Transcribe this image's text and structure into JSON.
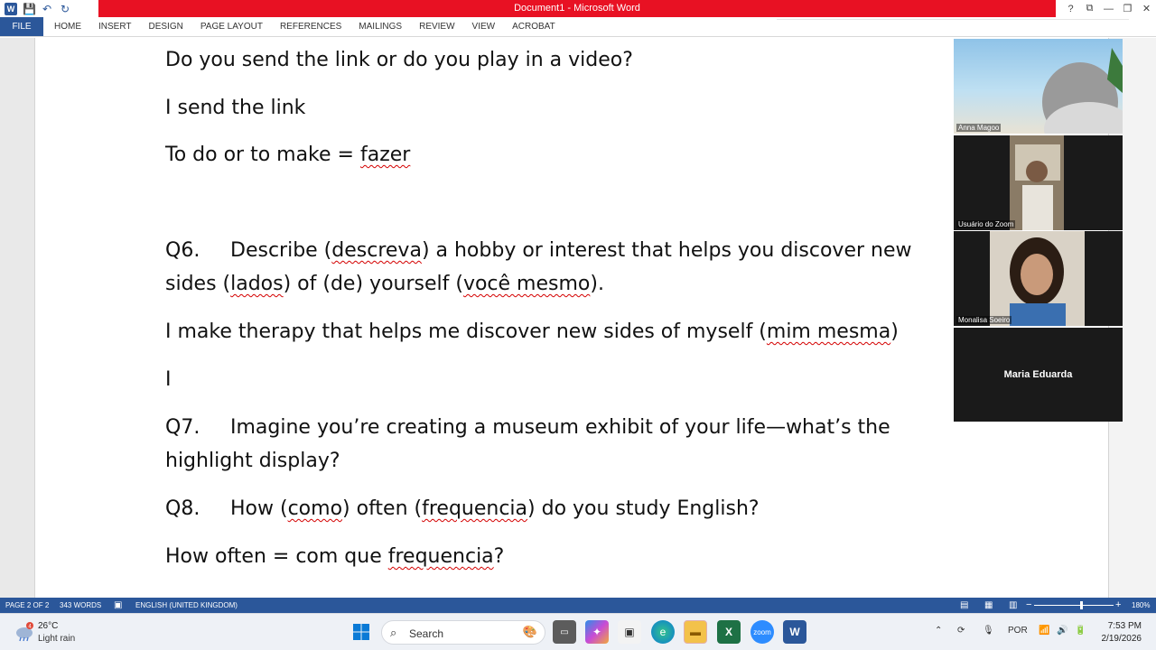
{
  "window": {
    "title": "Document1 - Microsoft Word",
    "controls": [
      "?",
      "⧉",
      "—",
      "❐",
      "✕"
    ]
  },
  "ribbon": {
    "file": "FILE",
    "tabs": [
      "HOME",
      "INSERT",
      "DESIGN",
      "PAGE LAYOUT",
      "REFERENCES",
      "MAILINGS",
      "REVIEW",
      "VIEW",
      "ACROBAT"
    ]
  },
  "document": {
    "line1": "Do you send the link or do you play in a video?",
    "line2": "I send the link",
    "line3_a": "To do or to make = ",
    "line3_b": "fazer",
    "q6": {
      "num": "Q6.",
      "t1": "Describe (",
      "w1": "descreva",
      "t2": ") a hobby or interest that helps you discover new sides (",
      "w2": "lados",
      "t3": ") of (de) yourself (",
      "w3": "você mesmo",
      "t4": ")."
    },
    "a6": {
      "t1": "I make therapy that helps me discover new sides of myself (",
      "w1": "mim mesma",
      "t2": ")"
    },
    "cursor_line": "I",
    "q7": {
      "num": "Q7.",
      "text": "Imagine you’re creating a museum exhibit of your life—what’s the highlight display?"
    },
    "q8": {
      "num": "Q8.",
      "t1": "How (",
      "w1": "como",
      "t2": ") often (",
      "w2": "frequencia",
      "t3": ") do you study English?"
    },
    "a8": {
      "t1": "How often = com que ",
      "w1": "frequencia",
      "t2": "?"
    }
  },
  "participants": [
    {
      "name": "Anna Magoo"
    },
    {
      "name": "Usuário do Zoom"
    },
    {
      "name": "Monalisa Soeiro"
    },
    {
      "name": "Maria Eduarda"
    }
  ],
  "status": {
    "page": "PAGE 2 OF 2",
    "words": "343 WORDS",
    "language": "ENGLISH (UNITED KINGDOM)",
    "zoom": "180%",
    "zoom_minus": "−",
    "zoom_plus": "+"
  },
  "taskbar": {
    "temperature": "26°C",
    "condition": "Light rain",
    "weather_badge": "4",
    "search_label": "Search",
    "language": "POR",
    "time": "7:53 PM",
    "date": "2/19/2026"
  },
  "colors": {
    "word_blue": "#2b579a",
    "title_red": "#e81123",
    "spell_red": "#d40000"
  }
}
